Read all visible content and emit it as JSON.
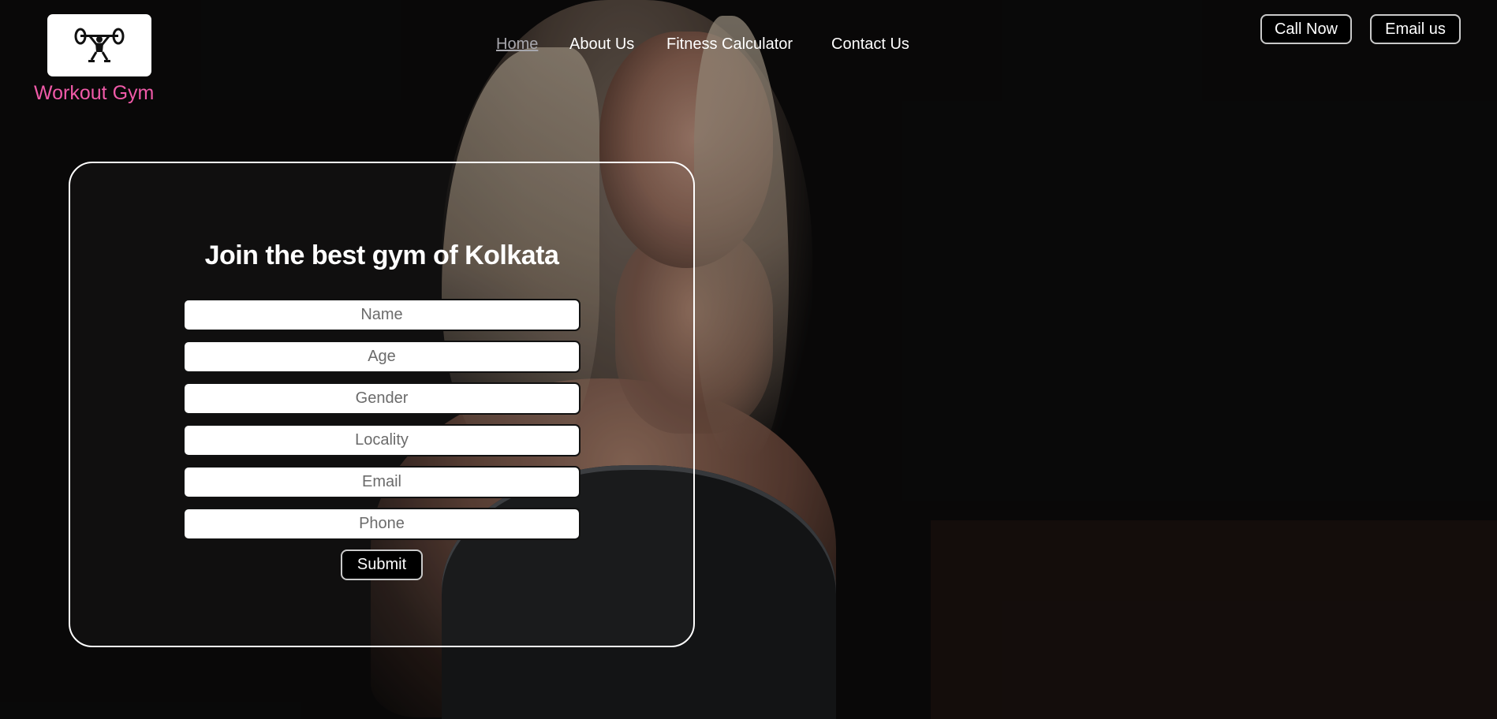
{
  "brand": {
    "name": "Workout Gym",
    "logo_icon": "weightlifter-icon",
    "color": "#f05aa8"
  },
  "nav": {
    "items": [
      {
        "label": "Home",
        "active": true
      },
      {
        "label": "About Us",
        "active": false
      },
      {
        "label": "Fitness Calculator",
        "active": false
      },
      {
        "label": "Contact Us",
        "active": false
      }
    ]
  },
  "header_actions": {
    "call_label": "Call Now",
    "email_label": "Email us"
  },
  "form": {
    "title": "Join the best gym of Kolkata",
    "fields": [
      {
        "placeholder": "Name"
      },
      {
        "placeholder": "Age"
      },
      {
        "placeholder": "Gender"
      },
      {
        "placeholder": "Locality"
      },
      {
        "placeholder": "Email"
      },
      {
        "placeholder": "Phone"
      }
    ],
    "submit_label": "Submit"
  },
  "colors": {
    "background": "#0d0c0c",
    "active_nav": "#a7a7ad",
    "card_border": "#ffffff"
  }
}
